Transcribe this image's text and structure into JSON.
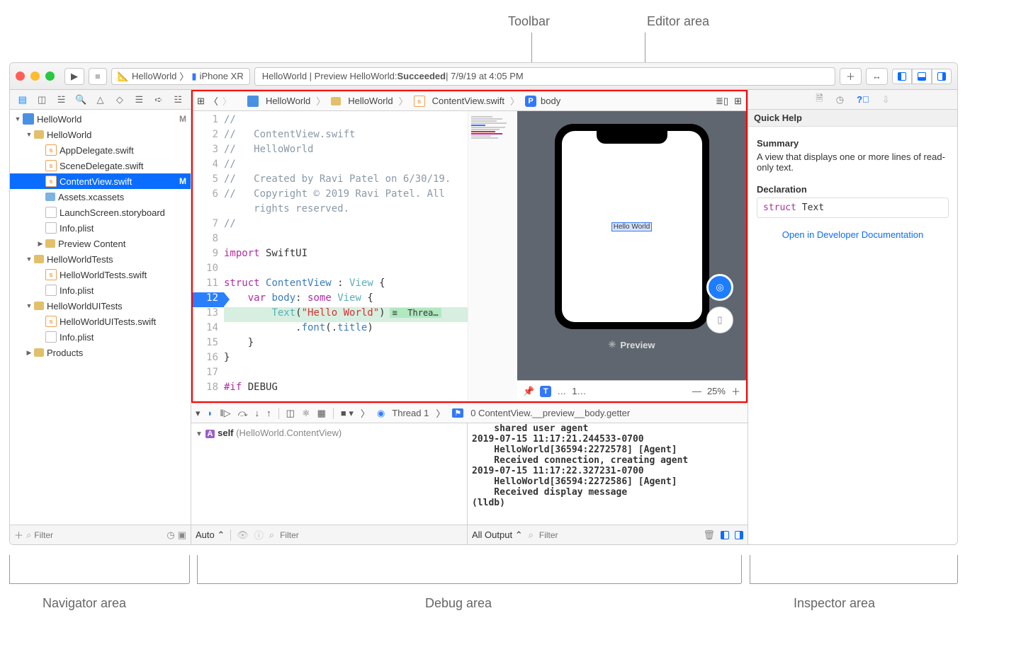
{
  "callouts": {
    "toolbar": "Toolbar",
    "editor": "Editor area",
    "navigator": "Navigator area",
    "debug": "Debug area",
    "inspector": "Inspector area"
  },
  "toolbar": {
    "scheme_project": "HelloWorld",
    "scheme_device": "iPhone XR",
    "status_prefix": "HelloWorld | Preview HelloWorld: ",
    "status_bold": "Succeeded",
    "status_suffix": " | 7/9/19 at 4:05 PM"
  },
  "navigator": {
    "tree": [
      {
        "depth": 0,
        "icon": "proj",
        "label": "HelloWorld",
        "disclosure": "▼",
        "badge": "M"
      },
      {
        "depth": 1,
        "icon": "folder",
        "label": "HelloWorld",
        "disclosure": "▼"
      },
      {
        "depth": 2,
        "icon": "swift",
        "label": "AppDelegate.swift"
      },
      {
        "depth": 2,
        "icon": "swift",
        "label": "SceneDelegate.swift"
      },
      {
        "depth": 2,
        "icon": "swift",
        "label": "ContentView.swift",
        "sel": true,
        "badge": "M"
      },
      {
        "depth": 2,
        "icon": "folder-blue",
        "label": "Assets.xcassets"
      },
      {
        "depth": 2,
        "icon": "sb",
        "label": "LaunchScreen.storyboard"
      },
      {
        "depth": 2,
        "icon": "plist",
        "label": "Info.plist"
      },
      {
        "depth": 2,
        "icon": "folder",
        "label": "Preview Content",
        "disclosure": "▶"
      },
      {
        "depth": 1,
        "icon": "folder",
        "label": "HelloWorldTests",
        "disclosure": "▼"
      },
      {
        "depth": 2,
        "icon": "swift",
        "label": "HelloWorldTests.swift"
      },
      {
        "depth": 2,
        "icon": "plist",
        "label": "Info.plist"
      },
      {
        "depth": 1,
        "icon": "folder",
        "label": "HelloWorldUITests",
        "disclosure": "▼"
      },
      {
        "depth": 2,
        "icon": "swift",
        "label": "HelloWorldUITests.swift"
      },
      {
        "depth": 2,
        "icon": "plist",
        "label": "Info.plist"
      },
      {
        "depth": 1,
        "icon": "folder",
        "label": "Products",
        "disclosure": "▶"
      }
    ],
    "filter_placeholder": "Filter"
  },
  "jumpbar": {
    "items": [
      "HelloWorld",
      "HelloWorld",
      "ContentView.swift",
      "body"
    ]
  },
  "code": {
    "lines": [
      {
        "n": 1,
        "html": "<span class='cmt'>//</span>"
      },
      {
        "n": 2,
        "html": "<span class='cmt'>//   ContentView.swift</span>"
      },
      {
        "n": 3,
        "html": "<span class='cmt'>//   HelloWorld</span>"
      },
      {
        "n": 4,
        "html": "<span class='cmt'>//</span>"
      },
      {
        "n": 5,
        "html": "<span class='cmt'>//   Created by Ravi Patel on 6/30/19.</span>"
      },
      {
        "n": 6,
        "html": "<span class='cmt'>//   Copyright © 2019 Ravi Patel. All</span>"
      },
      {
        "n": "",
        "html": "<span class='cmt'>     rights reserved.</span>"
      },
      {
        "n": 7,
        "html": "<span class='cmt'>//</span>"
      },
      {
        "n": 8,
        "html": ""
      },
      {
        "n": 9,
        "html": "<span class='kw'>import</span> SwiftUI"
      },
      {
        "n": 10,
        "html": ""
      },
      {
        "n": 11,
        "html": "<span class='kw'>struct</span> <span class='decl'>ContentView</span> : <span class='ty'>View</span> {"
      },
      {
        "n": 12,
        "bp": true,
        "html": "    <span class='kw'>var</span> <span class='decl'>body</span>: <span class='kw'>some</span> <span class='ty'>View</span> {"
      },
      {
        "n": 13,
        "hl": true,
        "html": "        <span class='ty'>Text</span>(<span class='str'>\"Hello World\"</span>)<span class='thread-badge'>≡  Threa…</span>"
      },
      {
        "n": 14,
        "html": "            .<span class='decl'>font</span>(.<span class='decl'>title</span>)"
      },
      {
        "n": 15,
        "html": "    }"
      },
      {
        "n": 16,
        "html": "}"
      },
      {
        "n": 17,
        "html": ""
      },
      {
        "n": 18,
        "html": "<span class='kw'>#if</span> DEBUG"
      }
    ]
  },
  "preview": {
    "text": "Hello World",
    "label": "Preview",
    "zoom": "25%",
    "page": "1…"
  },
  "debug": {
    "thread": "Thread 1",
    "frame": "0 ContentView.__preview__body.getter",
    "self_label": "self",
    "self_type": "(HelloWorld.ContentView)",
    "console": "    shared user agent\n2019-07-15 11:17:21.244533-0700\n    HelloWorld[36594:2272578] [Agent]\n    Received connection, creating agent\n2019-07-15 11:17:22.327231-0700\n    HelloWorld[36594:2272586] [Agent]\n    Received display message\n(lldb) ",
    "auto": "Auto",
    "all_output": "All Output",
    "filter_placeholder": "Filter"
  },
  "inspector": {
    "title": "Quick Help",
    "summary_h": "Summary",
    "summary": "A view that displays one or more lines of read-only text.",
    "decl_h": "Declaration",
    "decl_kw": "struct",
    "decl_name": "Text",
    "link": "Open in Developer Documentation"
  }
}
